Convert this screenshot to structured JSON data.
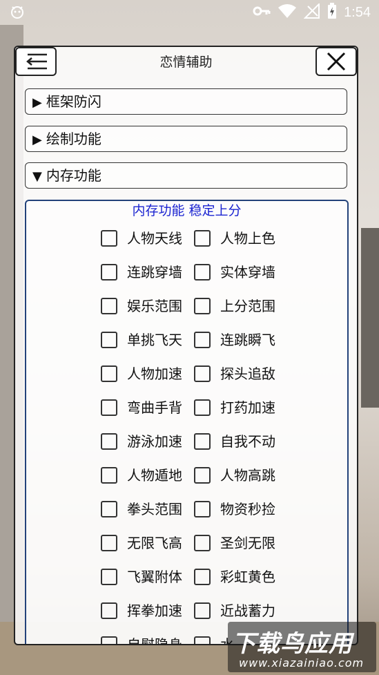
{
  "status_bar": {
    "time": "1:54",
    "icons": [
      "key-icon",
      "wifi-icon",
      "no-signal-icon",
      "battery-charging-icon"
    ]
  },
  "panel": {
    "title": "恋情辅助",
    "menu_icon": "collapse-menu-icon",
    "close_icon": "close-icon"
  },
  "sections": [
    {
      "arrow": "▶",
      "label": "框架防闪"
    },
    {
      "arrow": "▶",
      "label": "绘制功能"
    },
    {
      "arrow": "▼",
      "label": "内存功能"
    }
  ],
  "memory": {
    "title": "内存功能 稳定上分",
    "rows": [
      [
        "人物天线",
        "人物上色"
      ],
      [
        "连跳穿墙",
        "实体穿墙"
      ],
      [
        "娱乐范围",
        "上分范围"
      ],
      [
        "单挑飞天",
        "连跳瞬飞"
      ],
      [
        "人物加速",
        "探头追敌"
      ],
      [
        "弯曲手背",
        "打药加速"
      ],
      [
        "游泳加速",
        "自我不动"
      ],
      [
        "人物遁地",
        "人物高跳"
      ],
      [
        "拳头范围",
        "物资秒捡"
      ],
      [
        "无限飞高",
        "圣剑无限"
      ],
      [
        "飞翼附体",
        "彩虹黄色"
      ],
      [
        "挥拳加速",
        "近战蓄力"
      ],
      [
        "自慰隐身",
        "水"
      ]
    ]
  },
  "watermark": {
    "main": "下载鸟应用",
    "sub": "www.xiazainiao.com"
  }
}
